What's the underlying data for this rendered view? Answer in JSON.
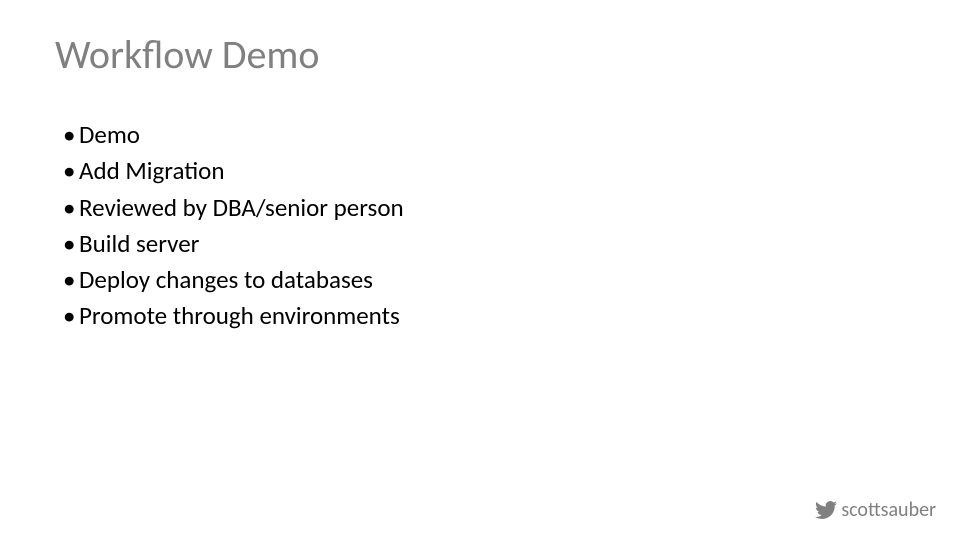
{
  "title": "Workflow Demo",
  "bullets": [
    "Demo",
    "Add Migration",
    "Reviewed by DBA/senior person",
    "Build server",
    "Deploy changes to databases",
    "Promote through environments"
  ],
  "footer": {
    "handle": "scottsauber",
    "icon_name": "twitter-icon"
  }
}
